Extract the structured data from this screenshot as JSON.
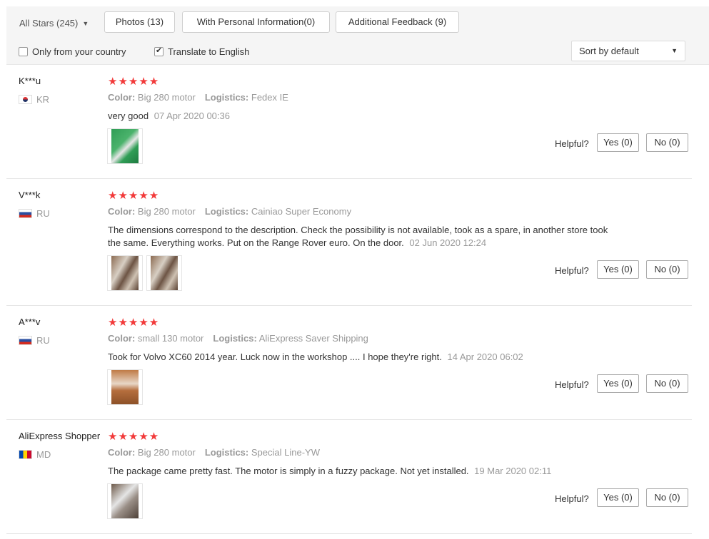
{
  "filters": {
    "all_stars": "All Stars (245)",
    "photos": "Photos (13)",
    "personal": "With Personal Information(0)",
    "additional": "Additional Feedback (9)",
    "only_country": "Only from your country",
    "translate": "Translate to English",
    "sort": "Sort by default"
  },
  "icons": {
    "chevron": "chevron-down-icon",
    "star": "star-icon",
    "checkbox": "checkbox-icon"
  },
  "colors": {
    "star": "#f23a3a",
    "muted": "#999999",
    "toolbar_bg": "#f5f5f5"
  },
  "labels": {
    "color": "Color:",
    "logistics": "Logistics:",
    "helpful": "Helpful?"
  },
  "reviews": [
    {
      "user": "K***u",
      "country": "KR",
      "stars": "★★★★★",
      "rating": 5,
      "color": "Big 280 motor",
      "logistics": "Fedex IE",
      "text": "very good",
      "date": "07 Apr 2020 00:36",
      "yes": "Yes (0)",
      "no": "No (0)"
    },
    {
      "user": "V***k",
      "country": "RU",
      "stars": "★★★★★",
      "rating": 5,
      "color": "Big 280 motor",
      "logistics": "Cainiao Super Economy",
      "text": "The dimensions correspond to the description. Check the possibility is not available, took as a spare, in another store took the same. Everything works. Put on the Range Rover euro. On the door.",
      "date": "02 Jun 2020 12:24",
      "yes": "Yes (0)",
      "no": "No (0)"
    },
    {
      "user": "A***v",
      "country": "RU",
      "stars": "★★★★★",
      "rating": 5,
      "color": "small 130 motor",
      "logistics": "AliExpress Saver Shipping",
      "text": "Took for Volvo XC60 2014 year. Luck now in the workshop .... I hope they're right.",
      "date": "14 Apr 2020 06:02",
      "yes": "Yes (0)",
      "no": "No (0)"
    },
    {
      "user": "AliExpress Shopper",
      "country": "MD",
      "stars": "★★★★★",
      "rating": 5,
      "color": "Big 280 motor",
      "logistics": "Special Line-YW",
      "text": "The package came pretty fast. The motor is simply in a fuzzy package. Not yet installed.",
      "date": "19 Mar 2020 02:11",
      "yes": "Yes (0)",
      "no": "No (0)"
    }
  ]
}
